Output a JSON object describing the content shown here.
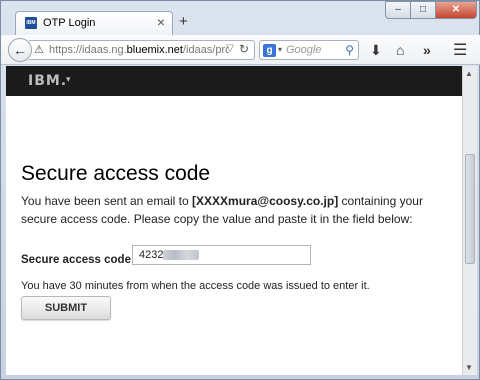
{
  "browser": {
    "tab_title": "OTP Login",
    "tab_icon_text": "IBM",
    "tab_close": "×",
    "new_tab": "+",
    "url_prefix": "https://idaas.ng.",
    "url_domain": "bluemix.net",
    "url_suffix": "/idaas/prote",
    "search_engine_letter": "g",
    "search_placeholder": "Google",
    "window_buttons": {
      "minimize": "–",
      "maximize": "□",
      "close": "✕"
    },
    "icons": {
      "back": "back-arrow-icon",
      "warning": "warning-icon",
      "reload": "reload-icon",
      "search": "magnifier-icon",
      "download": "download-icon",
      "home": "home-icon",
      "overflow": "chevron-double-right-icon",
      "menu": "hamburger-menu-icon"
    }
  },
  "header": {
    "logo": "IBM."
  },
  "main": {
    "title": "Secure access code",
    "intro_before": "You have been sent an email to ",
    "email": "[XXXXmura@coosy.co.jp]",
    "intro_after": " containing your secure access code. Please copy the value and paste it in the field below:",
    "field_label": "Secure access code:",
    "required_mark": "*",
    "code_value": "4232-",
    "note": "You have 30 minutes from when the access code was issued to enter it.",
    "submit_label": "SUBMIT"
  },
  "colors": {
    "ibm_bar": "#1b1b1b",
    "required": "#cc0000",
    "close_button": "#c5452e"
  }
}
